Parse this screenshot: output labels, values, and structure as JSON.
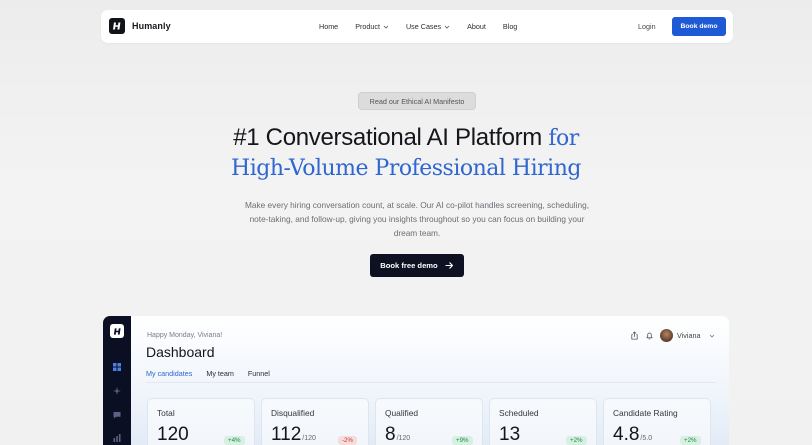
{
  "nav": {
    "brand": "Humanly",
    "links": [
      {
        "label": "Home",
        "has_dropdown": false
      },
      {
        "label": "Product",
        "has_dropdown": true
      },
      {
        "label": "Use Cases",
        "has_dropdown": true
      },
      {
        "label": "About",
        "has_dropdown": false
      },
      {
        "label": "Blog",
        "has_dropdown": false
      }
    ],
    "login": "Login",
    "book_demo": "Book demo"
  },
  "hero": {
    "pill": "Read our Ethical AI Manifesto",
    "title_part1": "#1 Conversational AI Platform",
    "title_part2": "for",
    "title_line2": "High-Volume Professional Hiring",
    "subtitle": "Make every hiring conversation count, at scale. Our AI co-pilot handles screening, scheduling, note-taking, and follow-up, giving you insights throughout so you can focus on building your dream team.",
    "cta": "Book free demo"
  },
  "dashboard": {
    "greeting": "Happy Monday, Viviana!",
    "title": "Dashboard",
    "user": "Viviana",
    "tabs": [
      "My candidates",
      "My team",
      "Funnel"
    ],
    "active_tab": "My candidates",
    "stats": [
      {
        "label": "Total",
        "value": "120",
        "of": "",
        "badge": "+4%",
        "trend": "up"
      },
      {
        "label": "Disqualified",
        "value": "112",
        "of": "/120",
        "badge": "-2%",
        "trend": "down"
      },
      {
        "label": "Qualified",
        "value": "8",
        "of": "/120",
        "badge": "+9%",
        "trend": "up"
      },
      {
        "label": "Scheduled",
        "value": "13",
        "of": "",
        "badge": "+2%",
        "trend": "up"
      },
      {
        "label": "Candidate Rating",
        "value": "4.8",
        "of": "/5.0",
        "badge": "+2%",
        "trend": "up"
      }
    ]
  },
  "colors": {
    "accent": "#1f5ad6",
    "serif_accent": "#2f66cf",
    "cta_dark": "#0e1122",
    "sidebar": "#0b0f24"
  }
}
